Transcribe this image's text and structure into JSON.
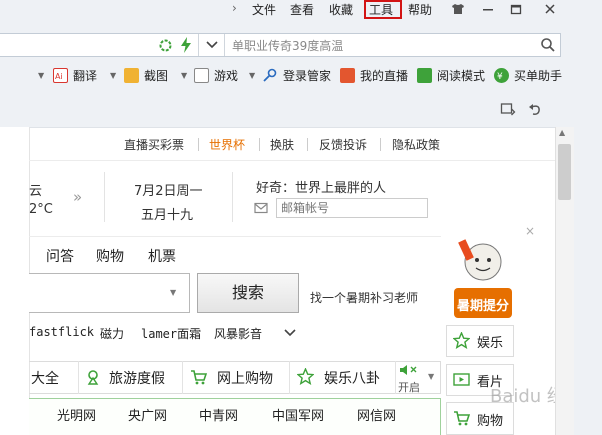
{
  "menubar": {
    "items": [
      "文件",
      "查看",
      "收藏",
      "工具",
      "帮助"
    ],
    "window_buttons": [
      "skin-shirt-icon",
      "minimize-icon",
      "maximize-icon",
      "close-icon"
    ]
  },
  "address": {
    "value": "单职业传奇39度高温"
  },
  "toolbar": {
    "items": [
      "翻译",
      "截图",
      "游戏",
      "登录管家",
      "我的直播",
      "阅读模式",
      "买单助手"
    ]
  },
  "top_links": [
    "直播买彩票",
    "世界杯",
    "换肤",
    "反馈投诉",
    "隐私政策"
  ],
  "weather": {
    "city_fragment": "云",
    "temp_fragment": "2°C"
  },
  "date": {
    "gregorian": "7月2日周一",
    "lunar": "五月十九"
  },
  "login": {
    "greeting": "好奇：世界上最胖的人",
    "email_placeholder": "邮箱帐号"
  },
  "search": {
    "tabs": [
      "问答",
      "购物",
      "机票"
    ],
    "button": "搜索",
    "hint": "找一个暑期补习老师",
    "hotwords": [
      "fastflick",
      "磁力",
      "lamer面霜",
      "风暴影音"
    ]
  },
  "ad": {
    "label": "暑期提分"
  },
  "categories": [
    "大全",
    "旅游度假",
    "网上购物",
    "娱乐八卦"
  ],
  "sound_toggle": "开启",
  "sites": [
    "光明网",
    "央广网",
    "中青网",
    "中国军网",
    "网信网"
  ],
  "sidebar": {
    "items": [
      "娱乐",
      "看片",
      "购物"
    ]
  },
  "watermark": "Baidu 经验",
  "colors": {
    "highlight_red": "#d21414",
    "accent_orange": "#e66f00",
    "green_icon": "#3ea23a"
  }
}
